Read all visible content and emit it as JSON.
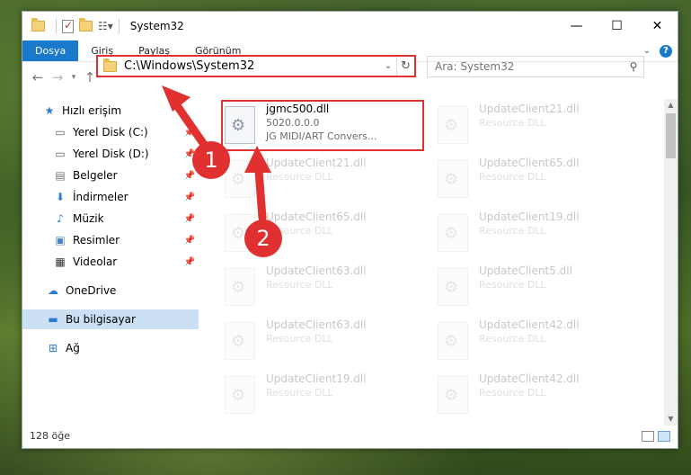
{
  "titlebar": {
    "title": "System32",
    "minimize": "—",
    "maximize": "☐",
    "close": "✕"
  },
  "ribbon": {
    "tabs": [
      "Dosya",
      "Giriş",
      "Paylaş",
      "Görünüm"
    ]
  },
  "address": {
    "path": "C:\\Windows\\System32"
  },
  "search": {
    "placeholder": "Ara: System32"
  },
  "sidebar": {
    "items": [
      {
        "label": "Hızlı erişim"
      },
      {
        "label": "Yerel Disk (C:)"
      },
      {
        "label": "Yerel Disk (D:)"
      },
      {
        "label": "Belgeler"
      },
      {
        "label": "İndirmeler"
      },
      {
        "label": "Müzik"
      },
      {
        "label": "Resimler"
      },
      {
        "label": "Videolar"
      },
      {
        "label": "OneDrive"
      },
      {
        "label": "Bu bilgisayar"
      },
      {
        "label": "Ağ"
      }
    ]
  },
  "files": {
    "main": {
      "name": "jgmc500.dll",
      "version": "5020.0.0.0",
      "desc": "JG MIDI/ART Convers..."
    },
    "left": [
      {
        "name": "UpdateClient21.dll",
        "desc": "Resource DLL"
      },
      {
        "name": "UpdateClient65.dll",
        "desc": "Resource DLL"
      },
      {
        "name": "UpdateClient63.dll",
        "desc": "Resource DLL"
      },
      {
        "name": "UpdateClient63.dll",
        "desc": "Resource DLL"
      },
      {
        "name": "UpdateClient19.dll",
        "desc": "Resource DLL"
      }
    ],
    "right": [
      {
        "name": "UpdateClient21.dll",
        "desc": "Resource DLL"
      },
      {
        "name": "UpdateClient65.dll",
        "desc": "Resource DLL"
      },
      {
        "name": "UpdateClient19.dll",
        "desc": "Resource DLL"
      },
      {
        "name": "UpdateClient5.dll",
        "desc": "Resource DLL"
      },
      {
        "name": "UpdateClient42.dll",
        "desc": "Resource DLL"
      },
      {
        "name": "UpdateClient42.dll",
        "desc": "Resource DLL"
      }
    ]
  },
  "status": {
    "count": "128 öğe"
  },
  "annotations": {
    "badge1": "1",
    "badge2": "2"
  },
  "colors": {
    "accent": "#1979ca",
    "highlight": "#e03030"
  }
}
